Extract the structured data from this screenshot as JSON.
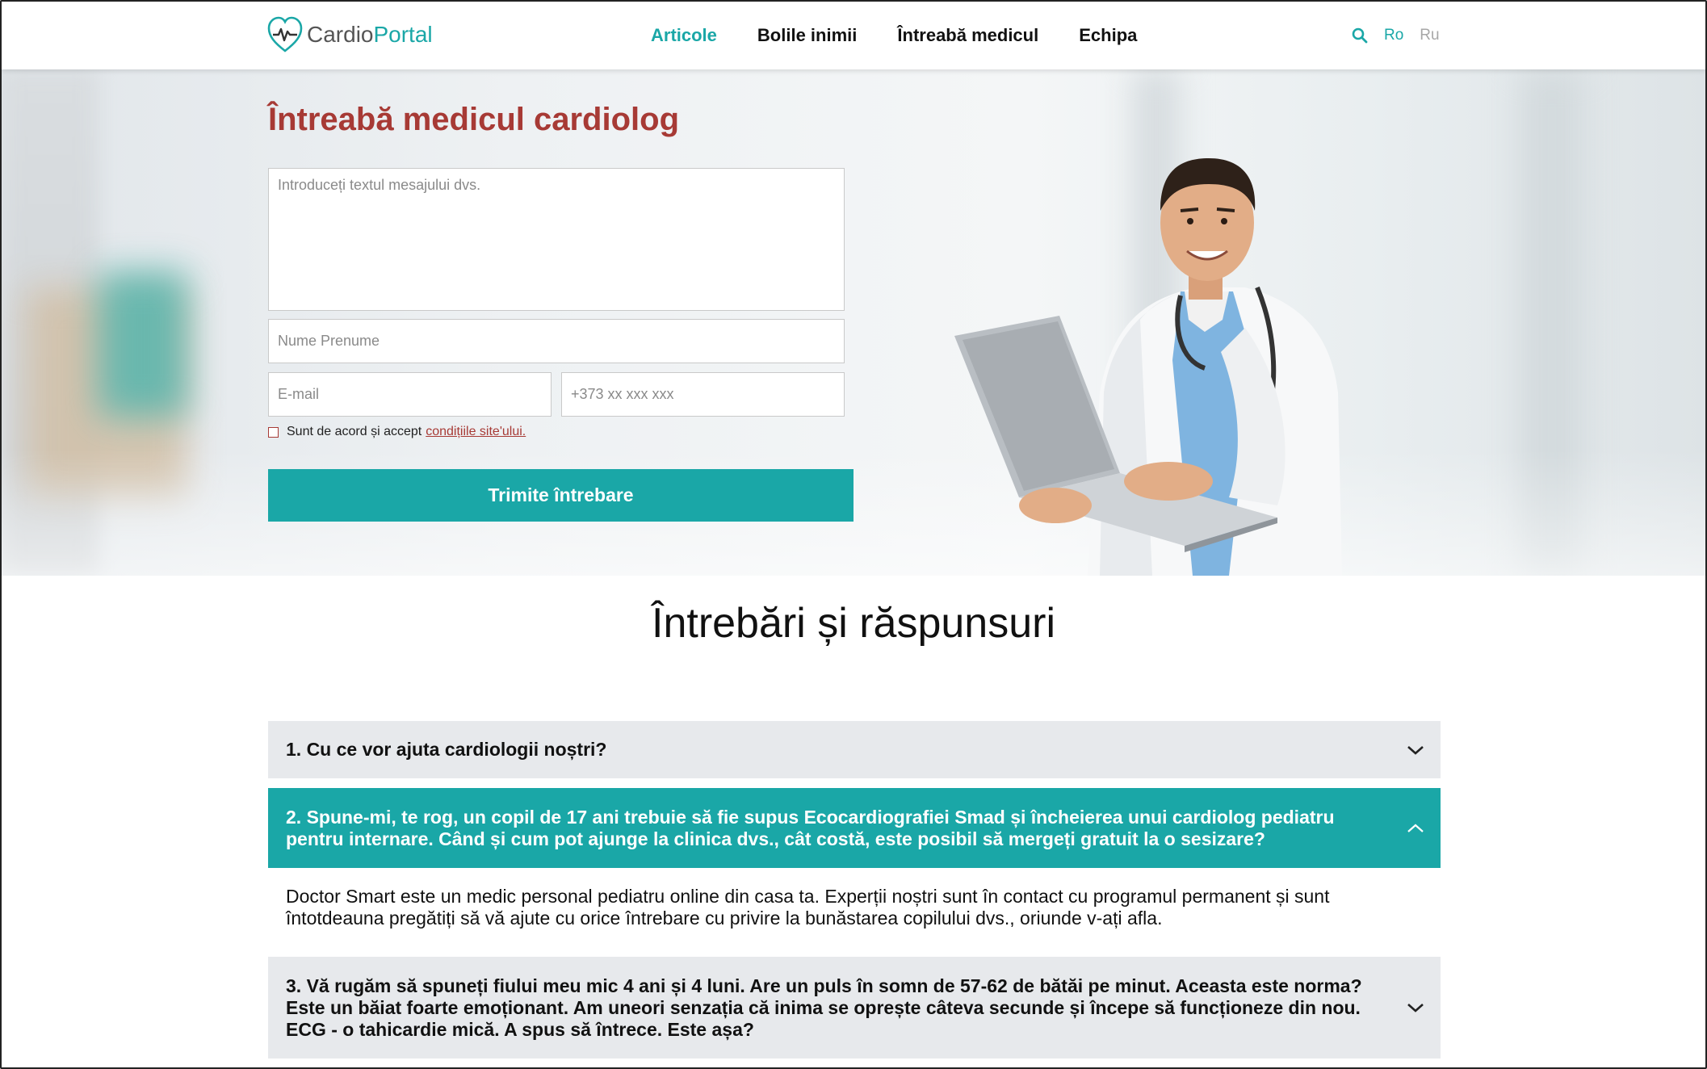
{
  "header": {
    "logo_part1": "Cardio",
    "logo_part2": "Portal",
    "nav": [
      "Articole",
      "Bolile inimii",
      "Întreabă medicul",
      "Echipa"
    ],
    "lang_ro": "Ro",
    "lang_ru": "Ru"
  },
  "form": {
    "title": "Întreabă medicul cardiolog",
    "message_placeholder": "Introduceți textul mesajului dvs.",
    "name_placeholder": "Nume Prenume",
    "email_placeholder": "E-mail",
    "phone_placeholder": "+373 xx xxx xxx",
    "agree_text": "Sunt de acord și accept",
    "agree_link": "condițiile site'ului.",
    "submit": "Trimite întrebare"
  },
  "faq": {
    "title": "Întrebări și răspunsuri",
    "items": [
      {
        "question": "1. Cu ce vor ajuta cardiologii noștri?"
      },
      {
        "question": "2. Spune-mi, te rog, un copil de 17 ani trebuie să fie supus Ecocardiografiei Smad și încheierea unui cardiolog pediatru pentru internare. Când și cum pot ajunge la clinica dvs., cât costă, este posibil să mergeți gratuit la o sesizare?",
        "answer": "Doctor Smart este un medic personal pediatru online din casa ta. Experții noștri sunt în contact cu programul permanent și sunt întotdeauna pregătiți să vă ajute cu orice întrebare cu privire la bunăstarea copilului dvs., oriunde v-ați afla."
      },
      {
        "question": "3. Vă rugăm să spuneți fiului meu mic 4 ani și 4 luni. Are un puls în somn de 57-62 de bătăi pe minut. Aceasta este norma? Este un băiat foarte emoționant. Am uneori senzația că inima se oprește câteva secunde și începe să funcționeze din nou. ECG - o tahicardie mică. A spus să întrece. Este așa?"
      }
    ]
  },
  "colors": {
    "accent": "#1aa7a7",
    "title_red": "#a73a35",
    "faq_bg": "#e7e9ec"
  }
}
